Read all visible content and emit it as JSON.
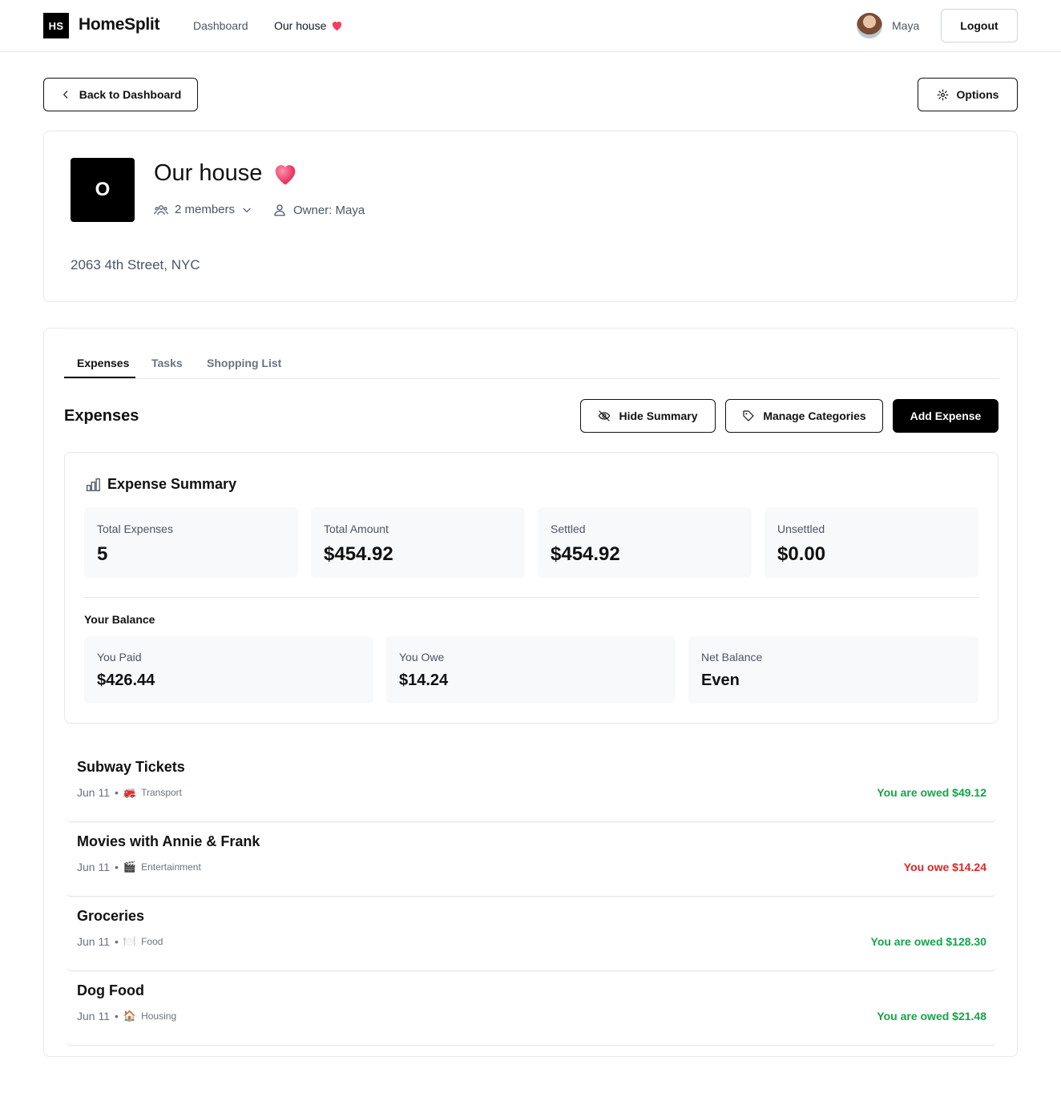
{
  "app": {
    "logo": "HS",
    "brand": "HomeSplit"
  },
  "nav": {
    "dashboard": "Dashboard",
    "house": "Our house",
    "house_emoji": "❤️"
  },
  "user": {
    "name": "Maya",
    "logout": "Logout"
  },
  "actions": {
    "back": "Back to Dashboard",
    "options": "Options"
  },
  "group": {
    "initial": "O",
    "title": "Our house",
    "emoji": "❤️",
    "members": "2 members",
    "owner": "Owner: Maya",
    "address": "2063 4th Street, NYC"
  },
  "tabs": [
    "Expenses",
    "Tasks",
    "Shopping List"
  ],
  "expenses": {
    "title": "Expenses",
    "hide_summary": "Hide Summary",
    "manage_categories": "Manage Categories",
    "add_expense": "Add Expense"
  },
  "summary": {
    "title": "Expense Summary",
    "stats": [
      {
        "label": "Total Expenses",
        "value": "5"
      },
      {
        "label": "Total Amount",
        "value": "$454.92"
      },
      {
        "label": "Settled",
        "value": "$454.92"
      },
      {
        "label": "Unsettled",
        "value": "$0.00"
      }
    ],
    "balance_title": "Your Balance",
    "balance": [
      {
        "label": "You Paid",
        "value": "$426.44"
      },
      {
        "label": "You Owe",
        "value": "$14.24"
      },
      {
        "label": "Net Balance",
        "value": "Even"
      }
    ]
  },
  "expense_items": [
    {
      "name": "Subway Tickets",
      "date": "Jun 11",
      "emoji": "🚒",
      "category": "Transport",
      "amount": "You are owed $49.12",
      "status": "positive"
    },
    {
      "name": "Movies with Annie & Frank",
      "date": "Jun 11",
      "emoji": "🎬",
      "category": "Entertainment",
      "amount": "You owe $14.24",
      "status": "negative"
    },
    {
      "name": "Groceries",
      "date": "Jun 11",
      "emoji": "🍽️",
      "category": "Food",
      "amount": "You are owed $128.30",
      "status": "positive"
    },
    {
      "name": "Dog Food",
      "date": "Jun 11",
      "emoji": "🏠",
      "category": "Housing",
      "amount": "You are owed $21.48",
      "status": "positive"
    }
  ],
  "colors": {
    "positive": "#16a34a",
    "negative": "#dc2626",
    "accent": "#000000"
  }
}
